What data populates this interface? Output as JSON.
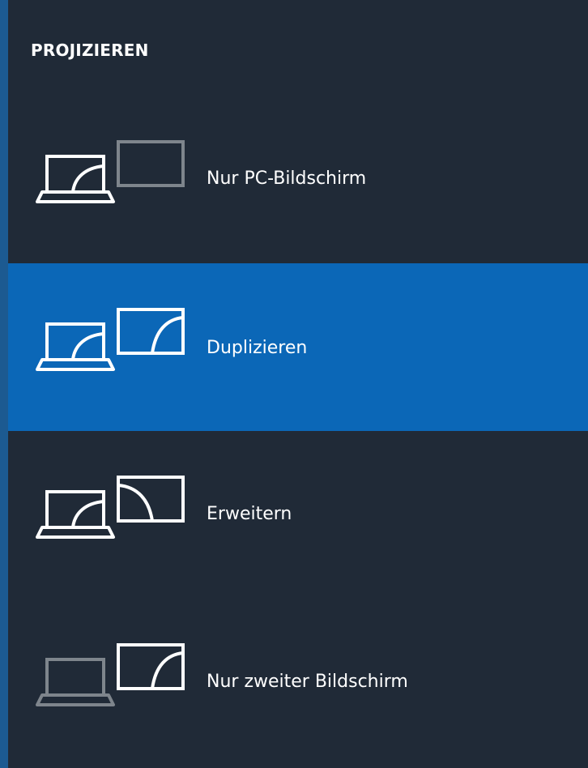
{
  "panel": {
    "title": "PROJIZIEREN",
    "options": [
      {
        "id": "pc-only",
        "label": "Nur PC-Bildschirm",
        "selected": false
      },
      {
        "id": "duplicate",
        "label": "Duplizieren",
        "selected": true
      },
      {
        "id": "extend",
        "label": "Erweitern",
        "selected": false
      },
      {
        "id": "second-only",
        "label": "Nur zweiter Bildschirm",
        "selected": false
      }
    ]
  },
  "colors": {
    "background": "#202a37",
    "selected": "#0b67b7",
    "foreground": "#ffffff",
    "dimmed": "#7e858c"
  },
  "icons": [
    "pc-screen-only-icon",
    "duplicate-icon",
    "extend-icon",
    "second-screen-only-icon"
  ]
}
